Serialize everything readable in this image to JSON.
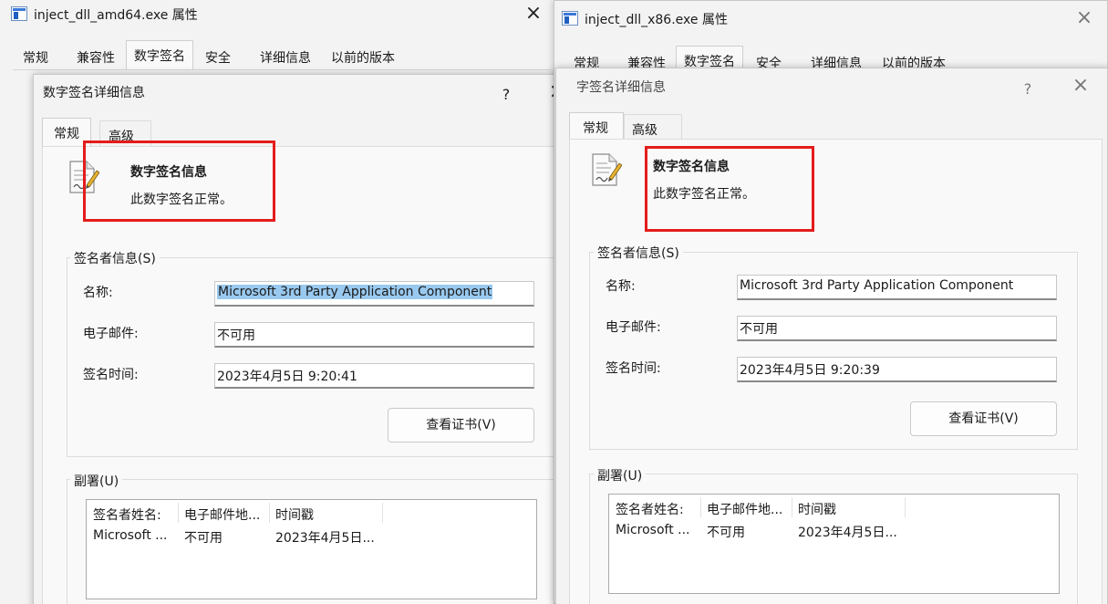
{
  "left": {
    "window_title": "inject_dll_amd64.exe 属性",
    "tabs": [
      "常规",
      "兼容性",
      "数字签名",
      "安全",
      "详细信息",
      "以前的版本"
    ],
    "dialog": {
      "title": "数字签名详细信息",
      "help_button": "?",
      "tabs": [
        "常规",
        "高级"
      ],
      "sig_info_title": "数字签名信息",
      "sig_info_status": "此数字签名正常。",
      "signer_group": "签名者信息(S)",
      "name_label": "名称:",
      "name_value": "Microsoft 3rd Party Application Component",
      "email_label": "电子邮件:",
      "email_value": "不可用",
      "time_label": "签名时间:",
      "time_value": "2023年4月5日 9:20:41",
      "view_cert_button": "查看证书(V)",
      "countersig_group": "副署(U)",
      "list_headers": [
        "签名者姓名:",
        "电子邮件地...",
        "时间戳"
      ],
      "list_row": [
        "Microsoft ...",
        "不可用",
        "2023年4月5日..."
      ]
    }
  },
  "right": {
    "window_title": "inject_dll_x86.exe 属性",
    "tabs": [
      "常规",
      "兼容性",
      "数字签名",
      "安全",
      "详细信息",
      "以前的版本"
    ],
    "dialog": {
      "title": "字签名详细信息",
      "help_button": "?",
      "tabs": [
        "常规",
        "高级"
      ],
      "sig_info_title": "数字签名信息",
      "sig_info_status": "此数字签名正常。",
      "signer_group": "签名者信息(S)",
      "name_label": "名称:",
      "name_value": "Microsoft 3rd Party Application Component",
      "email_label": "电子邮件:",
      "email_value": "不可用",
      "time_label": "签名时间:",
      "time_value": "2023年4月5日 9:20:39",
      "view_cert_button": "查看证书(V)",
      "countersig_group": "副署(U)",
      "list_headers": [
        "签名者姓名:",
        "电子邮件地...",
        "时间戳"
      ],
      "list_row": [
        "Microsoft ...",
        "不可用",
        "2023年4月5日..."
      ]
    }
  },
  "icons": {
    "close": "close-icon",
    "help": "help-icon",
    "app": "app-window-icon",
    "cert": "signed-document-icon"
  },
  "colors": {
    "highlight_box": "#e41c1c",
    "selection": "#99c9ef"
  }
}
